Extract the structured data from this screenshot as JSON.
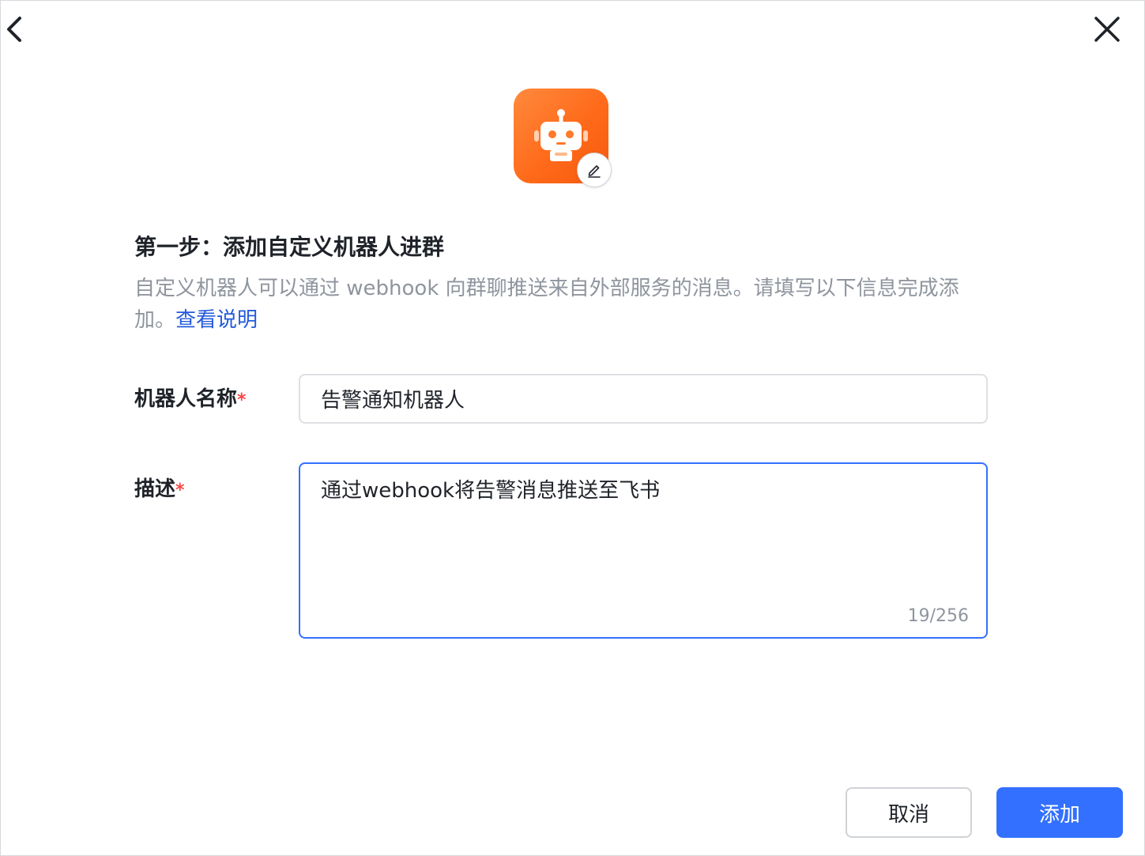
{
  "header": {
    "back_icon": "chevron-left-icon",
    "close_icon": "close-icon"
  },
  "avatar": {
    "icon": "robot-icon",
    "edit_icon": "pencil-icon",
    "gradient_start": "#ff8a3d",
    "gradient_end": "#f7590d"
  },
  "step": {
    "title": "第一步：添加自定义机器人进群",
    "description": "自定义机器人可以通过 webhook 向群聊推送来自外部服务的消息。请填写以下信息完成添加。",
    "help_link": "查看说明"
  },
  "form": {
    "name_label": "机器人名称",
    "name_required": "*",
    "name_value": "告警通知机器人",
    "desc_label": "描述",
    "desc_required": "*",
    "desc_value": "通过webhook将告警消息推送至飞书",
    "desc_counter": "19/256"
  },
  "footer": {
    "cancel_label": "取消",
    "add_label": "添加"
  },
  "colors": {
    "primary": "#3370ff",
    "link": "#245bdb",
    "required": "#f54a45",
    "muted_text": "#8f959e"
  }
}
